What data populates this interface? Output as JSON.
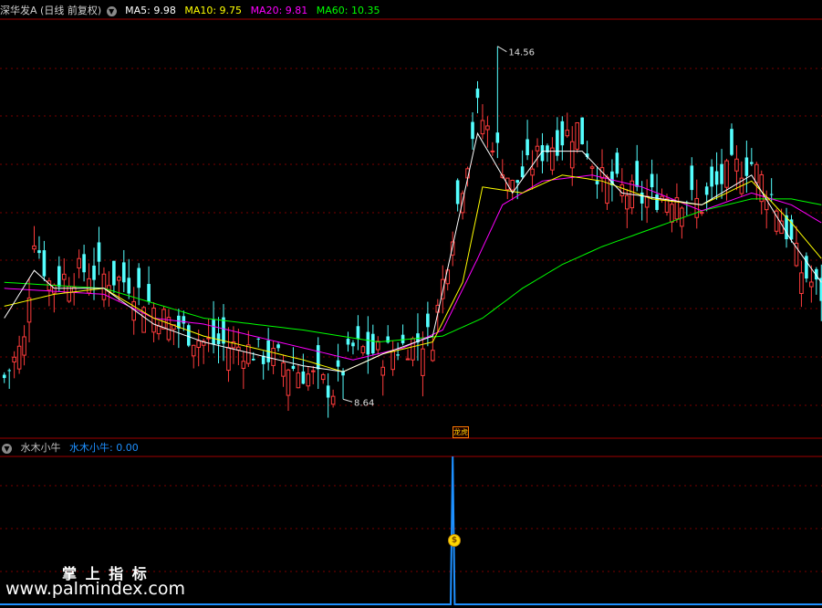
{
  "main_header": {
    "stock": "深华发A",
    "mode": "(日线 前复权)",
    "ma5": "MA5: 9.98",
    "ma10": "MA10: 9.75",
    "ma20": "MA20: 9.81",
    "ma60": "MA60: 10.35"
  },
  "sub_header": {
    "indicator": "水木小牛",
    "value": "水木小牛: 0.00"
  },
  "watermark": {
    "title": "掌 上 指 标",
    "url": "www.palmindex.com"
  },
  "event_tag": "龙虎",
  "colors": {
    "up": "#ff3c3c",
    "down": "#54ffff",
    "ma5": "#ffffff",
    "ma10": "#ffff00",
    "ma20": "#ff00ff",
    "ma60": "#00ff00",
    "indicator": "#1e90ff",
    "grid": "#7a0000"
  },
  "chart_data": [
    {
      "type": "candlestick",
      "title": "深华发A (日线 前复权)",
      "annotations": {
        "high": "14.56",
        "low": "8.64"
      },
      "ylim": [
        8.2,
        15.0
      ],
      "series": [
        {
          "name": "MA5",
          "value": 9.98
        },
        {
          "name": "MA10",
          "value": 9.75
        },
        {
          "name": "MA20",
          "value": 9.81
        },
        {
          "name": "MA60",
          "value": 10.35
        }
      ],
      "knots": {
        "close": [
          [
            0,
            9.0
          ],
          [
            4,
            9.6
          ],
          [
            6,
            11.4
          ],
          [
            9,
            10.6
          ],
          [
            16,
            10.8
          ],
          [
            25,
            10.6
          ],
          [
            32,
            10.0
          ],
          [
            40,
            9.6
          ],
          [
            48,
            9.5
          ],
          [
            55,
            9.3
          ],
          [
            62,
            9.0
          ],
          [
            66,
            8.8
          ],
          [
            70,
            9.5
          ],
          [
            76,
            9.4
          ],
          [
            82,
            9.6
          ],
          [
            86,
            9.7
          ],
          [
            90,
            11.5
          ],
          [
            95,
            13.5
          ],
          [
            98,
            13.0
          ],
          [
            102,
            12.2
          ],
          [
            108,
            12.8
          ],
          [
            115,
            13.2
          ],
          [
            120,
            12.3
          ],
          [
            128,
            12.0
          ],
          [
            135,
            12.1
          ],
          [
            140,
            11.9
          ],
          [
            146,
            12.5
          ],
          [
            150,
            12.6
          ],
          [
            155,
            11.9
          ],
          [
            160,
            10.8
          ],
          [
            164,
            10.4
          ]
        ],
        "ma5": [
          [
            0,
            10.0
          ],
          [
            6,
            10.8
          ],
          [
            10,
            10.5
          ],
          [
            20,
            10.5
          ],
          [
            30,
            9.9
          ],
          [
            40,
            9.6
          ],
          [
            50,
            9.4
          ],
          [
            60,
            9.2
          ],
          [
            68,
            9.1
          ],
          [
            76,
            9.4
          ],
          [
            86,
            9.7
          ],
          [
            95,
            13.1
          ],
          [
            102,
            12.1
          ],
          [
            108,
            12.8
          ],
          [
            116,
            12.8
          ],
          [
            124,
            12.1
          ],
          [
            132,
            12.0
          ],
          [
            140,
            11.9
          ],
          [
            150,
            12.4
          ],
          [
            158,
            11.3
          ],
          [
            164,
            10.6
          ]
        ],
        "ma10": [
          [
            0,
            10.2
          ],
          [
            10,
            10.4
          ],
          [
            20,
            10.5
          ],
          [
            30,
            10.0
          ],
          [
            40,
            9.7
          ],
          [
            50,
            9.5
          ],
          [
            60,
            9.3
          ],
          [
            68,
            9.1
          ],
          [
            76,
            9.4
          ],
          [
            86,
            9.6
          ],
          [
            92,
            10.6
          ],
          [
            96,
            12.2
          ],
          [
            104,
            12.1
          ],
          [
            112,
            12.4
          ],
          [
            120,
            12.3
          ],
          [
            130,
            12.0
          ],
          [
            140,
            11.9
          ],
          [
            150,
            12.3
          ],
          [
            158,
            11.6
          ],
          [
            164,
            11.0
          ]
        ],
        "ma20": [
          [
            0,
            10.5
          ],
          [
            20,
            10.4
          ],
          [
            30,
            10.0
          ],
          [
            40,
            9.9
          ],
          [
            50,
            9.7
          ],
          [
            60,
            9.5
          ],
          [
            70,
            9.3
          ],
          [
            80,
            9.5
          ],
          [
            88,
            9.8
          ],
          [
            95,
            11.0
          ],
          [
            100,
            11.9
          ],
          [
            108,
            12.3
          ],
          [
            118,
            12.4
          ],
          [
            128,
            12.2
          ],
          [
            140,
            11.8
          ],
          [
            150,
            12.1
          ],
          [
            158,
            11.9
          ],
          [
            164,
            11.6
          ]
        ],
        "ma60": [
          [
            0,
            10.6
          ],
          [
            20,
            10.5
          ],
          [
            40,
            10.0
          ],
          [
            60,
            9.8
          ],
          [
            75,
            9.6
          ],
          [
            88,
            9.7
          ],
          [
            96,
            10.0
          ],
          [
            104,
            10.5
          ],
          [
            112,
            10.9
          ],
          [
            120,
            11.2
          ],
          [
            130,
            11.5
          ],
          [
            140,
            11.8
          ],
          [
            150,
            12.0
          ],
          [
            158,
            12.0
          ],
          [
            164,
            11.9
          ]
        ]
      },
      "extremes": {
        "high": {
          "index": 99,
          "value": 14.56
        },
        "low": {
          "index": 68,
          "value": 8.64
        }
      }
    },
    {
      "type": "line",
      "title": "水木小牛",
      "series": [
        {
          "name": "水木小牛",
          "current": 0.0
        }
      ],
      "n": 165,
      "spike": {
        "index": 90,
        "value": 1.0
      }
    }
  ]
}
